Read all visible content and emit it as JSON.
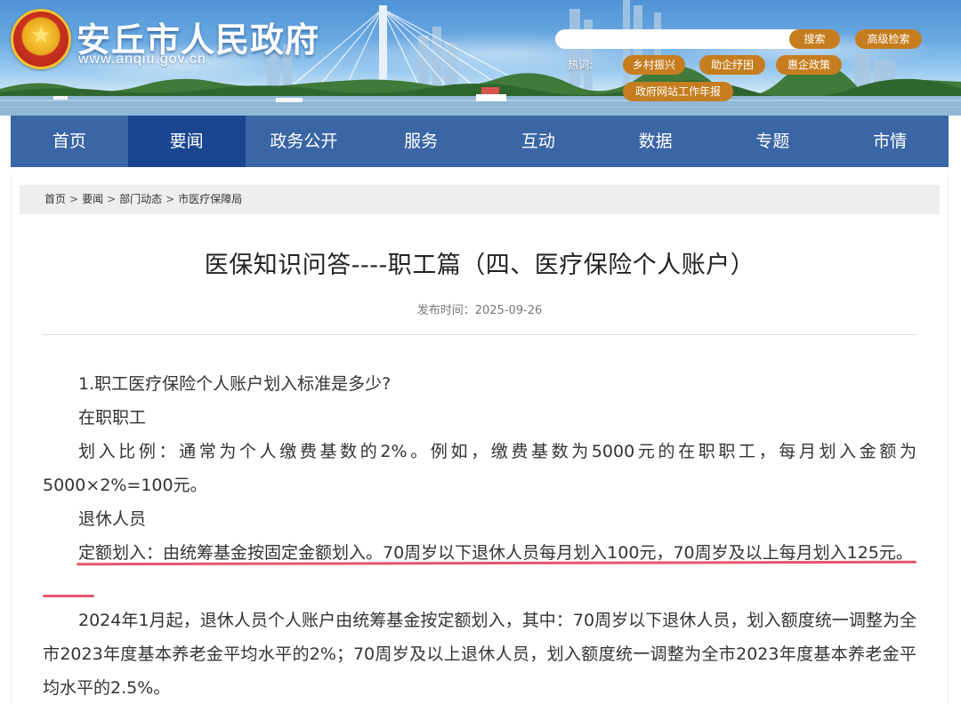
{
  "site": {
    "title": "安丘市人民政府",
    "url": "www.anqiu.gov.cn"
  },
  "search": {
    "placeholder": "",
    "button_label": "搜索",
    "advanced_label": "高级检索"
  },
  "hot": {
    "label": "热词:",
    "tags": [
      "乡村振兴",
      "助企纾困",
      "惠企政策",
      "政府网站工作年报"
    ]
  },
  "nav": {
    "items": [
      "首页",
      "要闻",
      "政务公开",
      "服务",
      "互动",
      "数据",
      "专题",
      "市情"
    ],
    "active": "要闻"
  },
  "breadcrumb": {
    "items": [
      "首页",
      "要闻",
      "部门动态",
      "市医疗保障局"
    ],
    "separator": ">"
  },
  "article": {
    "title": "医保知识问答----职工篇（四、医疗保险个人账户）",
    "publish_label": "发布时间：",
    "publish_date": "2025-09-26",
    "paragraphs": [
      "1.职工医疗保险个人账户划入标准是多少?",
      "在职职工",
      "划入比例：通常为个人缴费基数的2%。例如，缴费基数为5000元的在职职工，每月划入金额为5000×2%=100元。",
      "退休人员",
      "定额划入：由统筹基金按固定金额划入。70周岁以下退休人员每月划入100元，70周岁及以上每月划入125元。",
      "2024年1月起，退休人员个人账户由统筹基金按定额划入，其中：70周岁以下退休人员，划入额度统一调整为全市2023年度基本养老金平均水平的2%；70周岁及以上退休人员，划入额度统一调整为全市2023年度基本养老金平均水平的2.5%。"
    ]
  },
  "colors": {
    "nav_bg": "#3b66a6",
    "nav_active": "#1a4590",
    "pill": "#c67d1f",
    "highlight_underline": "#e2566e"
  }
}
